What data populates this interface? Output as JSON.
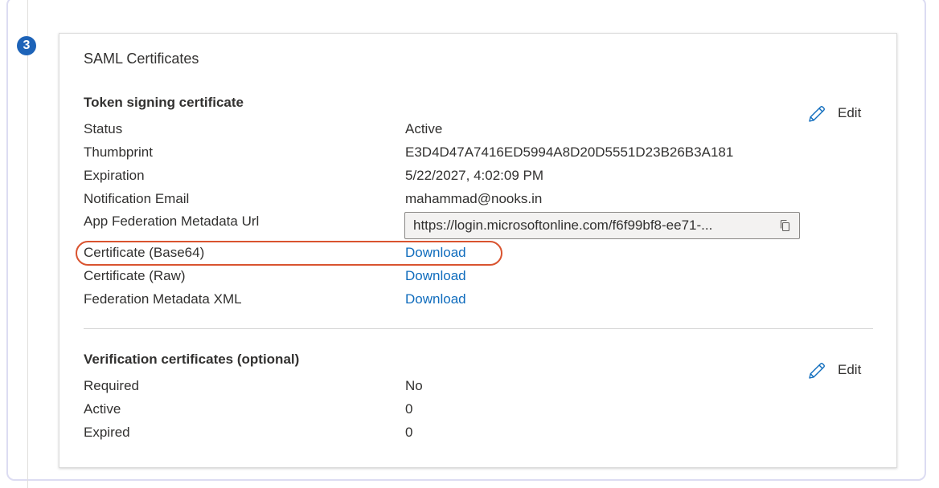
{
  "step": {
    "number": "3"
  },
  "card": {
    "title": "SAML Certificates"
  },
  "token_signing": {
    "title": "Token signing certificate",
    "edit_label": "Edit",
    "rows": [
      {
        "label": "Status",
        "value": "Active"
      },
      {
        "label": "Thumbprint",
        "value": "E3D4D47A7416ED5994A8D20D5551D23B26B3A181"
      },
      {
        "label": "Expiration",
        "value": "5/22/2027, 4:02:09 PM"
      },
      {
        "label": "Notification Email",
        "value": "mahammad@nooks.in"
      },
      {
        "label": "App Federation Metadata Url",
        "value": "https://login.microsoftonline.com/f6f99bf8-ee71-..."
      },
      {
        "label": "Certificate (Base64)",
        "value": "Download"
      },
      {
        "label": "Certificate (Raw)",
        "value": "Download"
      },
      {
        "label": "Federation Metadata XML",
        "value": "Download"
      }
    ]
  },
  "verification": {
    "title": "Verification certificates (optional)",
    "edit_label": "Edit",
    "rows": [
      {
        "label": "Required",
        "value": "No"
      },
      {
        "label": "Active",
        "value": "0"
      },
      {
        "label": "Expired",
        "value": "0"
      }
    ]
  },
  "colors": {
    "accent": "#0f6cbd",
    "step_badge": "#1d63b8",
    "highlight": "#d9532f"
  },
  "icons": {
    "edit": "pencil-icon",
    "copy": "copy-icon"
  }
}
